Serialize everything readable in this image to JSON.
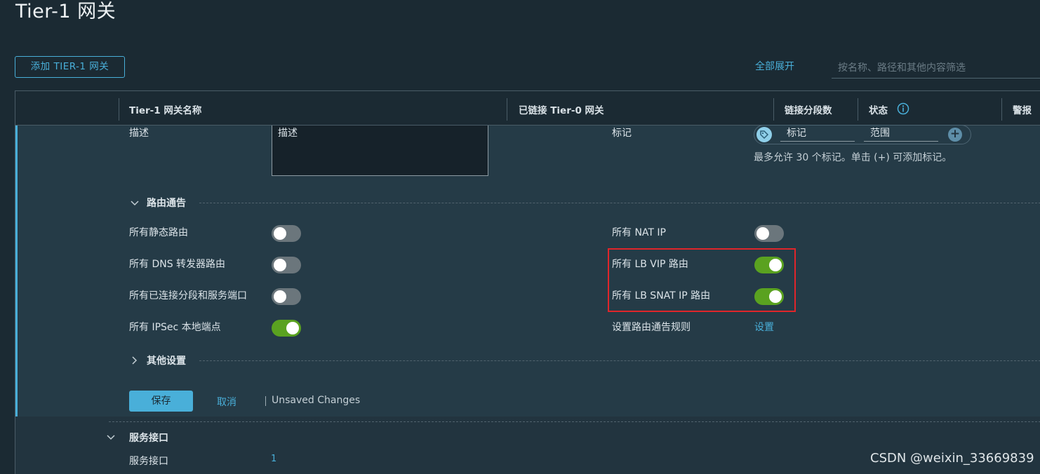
{
  "page": {
    "title": "Tier-1 网关"
  },
  "toolbar": {
    "add_button": "添加 TIER-1 网关",
    "expand_all": "全部展开",
    "filter_placeholder": "按名称、路径和其他内容筛选"
  },
  "grid": {
    "columns": [
      "Tier-1 网关名称",
      "已链接 Tier-0 网关",
      "链接分段数",
      "状态",
      "警报"
    ]
  },
  "detail": {
    "description_label": "描述",
    "description_value": "描述",
    "tags_label": "标记",
    "tag_placeholder": "标记",
    "scope_placeholder": "范围",
    "tags_hint": "最多允许 30 个标记。单击 (+) 可添加标记。",
    "route_adv_title": "路由通告",
    "left_toggles": [
      {
        "label": "所有静态路由",
        "on": false
      },
      {
        "label": "所有 DNS 转发器路由",
        "on": false
      },
      {
        "label": "所有已连接分段和服务端口",
        "on": false
      },
      {
        "label": "所有 IPSec 本地端点",
        "on": true
      }
    ],
    "right_toggles": [
      {
        "label": "所有 NAT IP",
        "on": false
      },
      {
        "label": "所有 LB VIP 路由",
        "on": true
      },
      {
        "label": "所有 LB SNAT IP 路由",
        "on": true
      }
    ],
    "rules_label": "设置路由通告规则",
    "rules_link": "设置",
    "other_settings_title": "其他设置",
    "save": "保存",
    "cancel": "取消",
    "unsaved": "Unsaved Changes"
  },
  "service_interfaces": {
    "section_title": "服务接口",
    "label": "服务接口",
    "count": "1"
  },
  "watermark": "CSDN @weixin_33669839",
  "colors": {
    "accent": "#49afd9",
    "toggle_on": "#5aa220",
    "highlight": "#e0252a"
  }
}
